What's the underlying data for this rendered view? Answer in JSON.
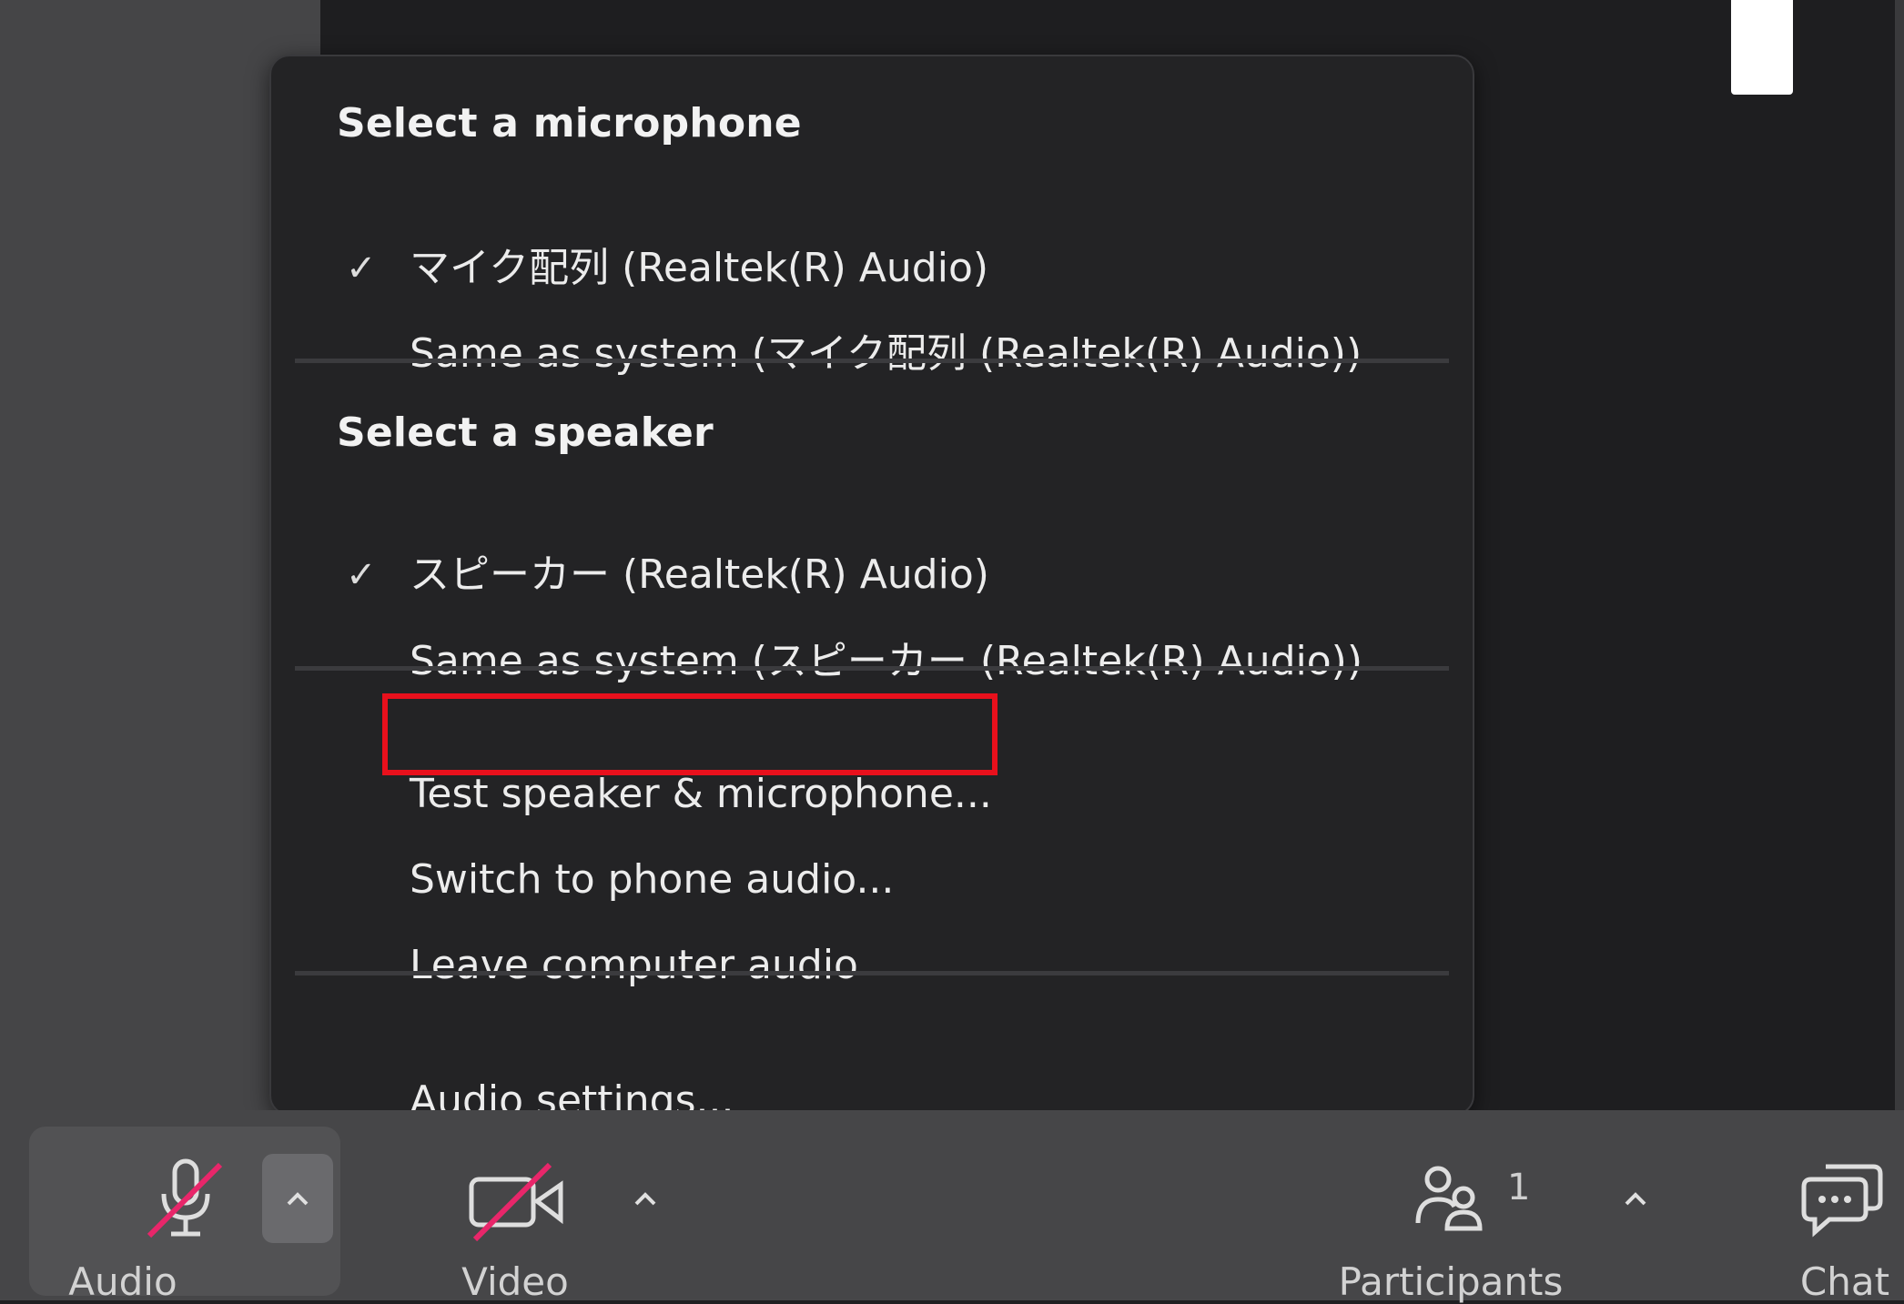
{
  "menu": {
    "microphone_header": "Select a microphone",
    "microphone_items": [
      {
        "label": "マイク配列 (Realtek(R) Audio)",
        "checked": true
      },
      {
        "label": "Same as system (マイク配列 (Realtek(R) Audio))",
        "checked": false
      }
    ],
    "speaker_header": "Select a speaker",
    "speaker_items": [
      {
        "label": "スピーカー (Realtek(R) Audio)",
        "checked": true
      },
      {
        "label": "Same as system (スピーカー (Realtek(R) Audio))",
        "checked": false
      }
    ],
    "test_label": "Test speaker & microphone...",
    "switch_phone_label": "Switch to phone audio...",
    "leave_audio_label": "Leave computer audio",
    "settings_label": "Audio settings...",
    "check_glyph": "✓"
  },
  "toolbar": {
    "audio_label": "Audio",
    "video_label": "Video",
    "participants_label": "Participants",
    "participants_count": "1",
    "chat_label": "Chat"
  },
  "colors": {
    "highlight": "#e8101c",
    "mute_slash": "#e8266a",
    "menu_bg": "#232325",
    "toolbar_bg": "#464648"
  }
}
